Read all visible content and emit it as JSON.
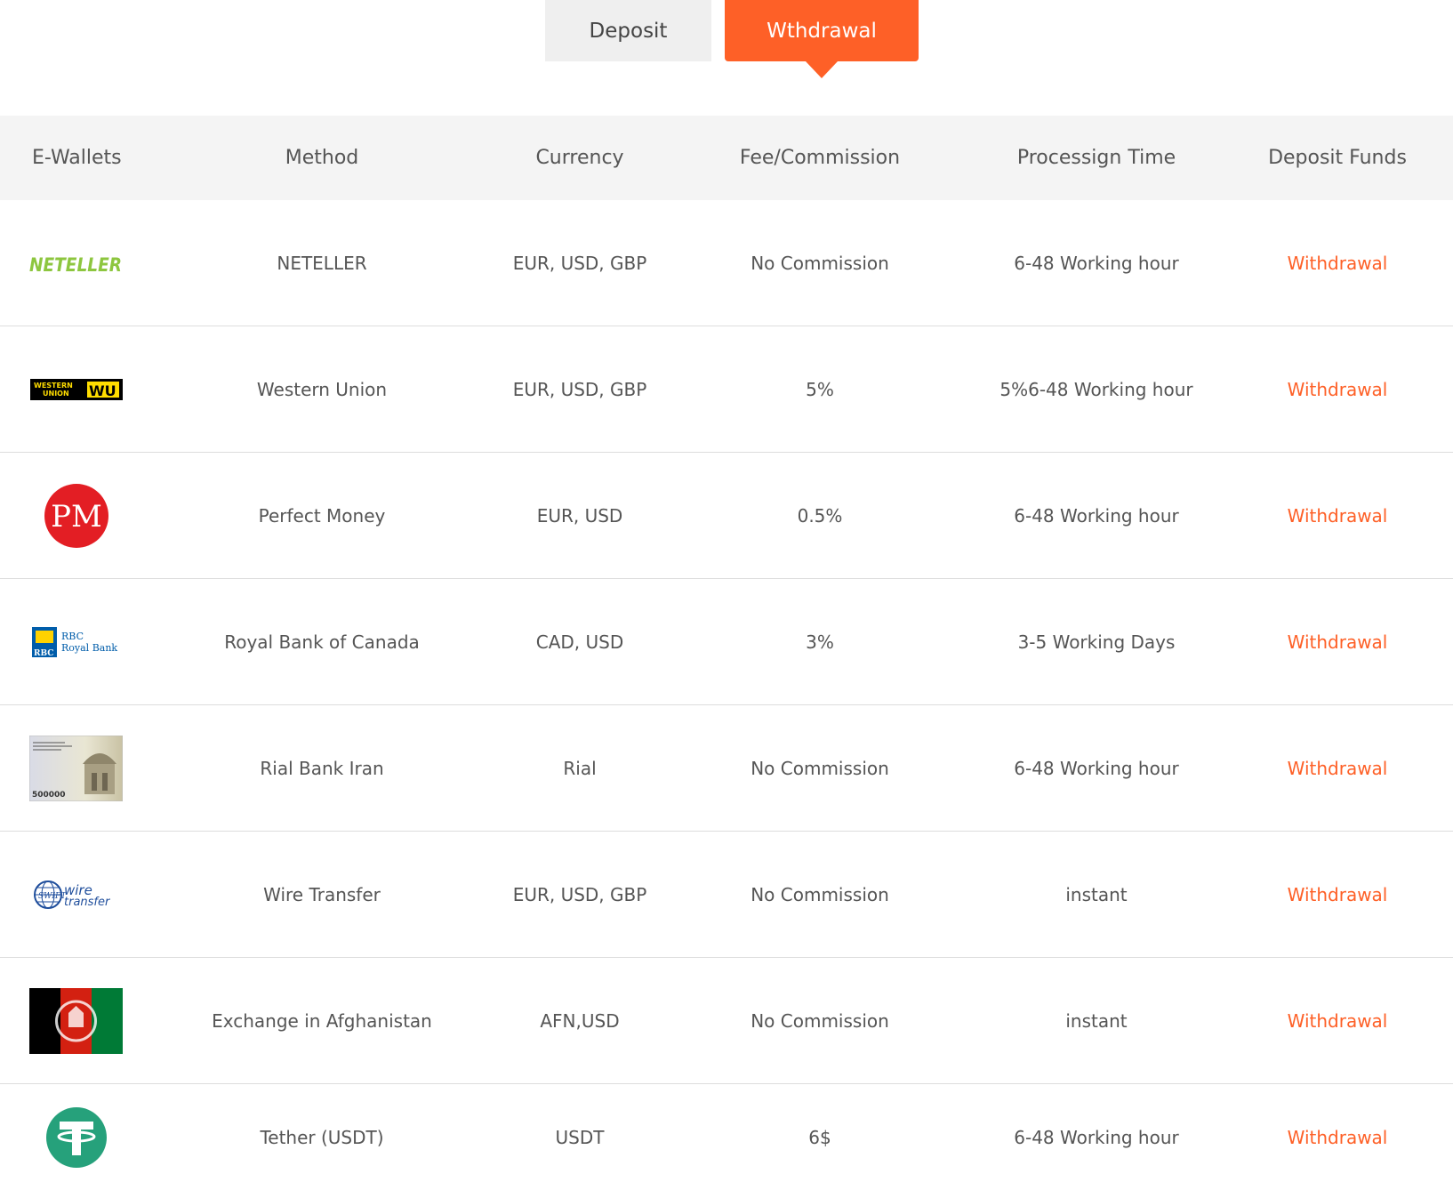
{
  "tabs": {
    "deposit": "Deposit",
    "withdrawal": "Wthdrawal",
    "active": "withdrawal"
  },
  "colors": {
    "accent": "#fe6027",
    "header_bg": "#f4f4f4",
    "inactive_tab_bg": "#efefef"
  },
  "table": {
    "headers": [
      "E-Wallets",
      "Method",
      "Currency",
      "Fee/Commission",
      "Processign Time",
      "Deposit Funds"
    ],
    "rows": [
      {
        "logo": "neteller-logo",
        "logo_text": "NETELLER",
        "method": "NETELLER",
        "currency": "EUR, USD, GBP",
        "fee": "No Commission",
        "time": "6-48 Working hour",
        "action": "Withdrawal"
      },
      {
        "logo": "western-union-logo",
        "logo_text": "WESTERN UNION WU",
        "method": "Western Union",
        "currency": "EUR, USD, GBP",
        "fee": "5%",
        "time": "5%6-48 Working hour",
        "action": "Withdrawal"
      },
      {
        "logo": "perfect-money-logo",
        "logo_text": "PM",
        "method": "Perfect Money",
        "currency": "EUR, USD",
        "fee": "0.5%",
        "time": "6-48 Working hour",
        "action": "Withdrawal"
      },
      {
        "logo": "rbc-logo",
        "logo_text": "RBC Royal Bank",
        "method": "Royal Bank of Canada",
        "currency": "CAD, USD",
        "fee": "3%",
        "time": "3-5 Working Days",
        "action": "Withdrawal"
      },
      {
        "logo": "rial-banknote-image",
        "logo_text": "500000",
        "method": "Rial Bank Iran",
        "currency": "Rial",
        "fee": "No Commission",
        "time": "6-48 Working hour",
        "action": "Withdrawal"
      },
      {
        "logo": "swift-wire-logo",
        "logo_text": "wire transfer",
        "method": "Wire Transfer",
        "currency": "EUR, USD, GBP",
        "fee": "No Commission",
        "time": "instant",
        "action": "Withdrawal"
      },
      {
        "logo": "afghanistan-flag-image",
        "logo_text": "",
        "method": "Exchange in Afghanistan",
        "currency": "AFN,USD",
        "fee": "No Commission",
        "time": "instant",
        "action": "Withdrawal"
      },
      {
        "logo": "tether-logo",
        "logo_text": "T",
        "method": "Tether (USDT)",
        "currency": "USDT",
        "fee": "6$",
        "time": "6-48 Working hour",
        "action": "Withdrawal"
      }
    ]
  }
}
